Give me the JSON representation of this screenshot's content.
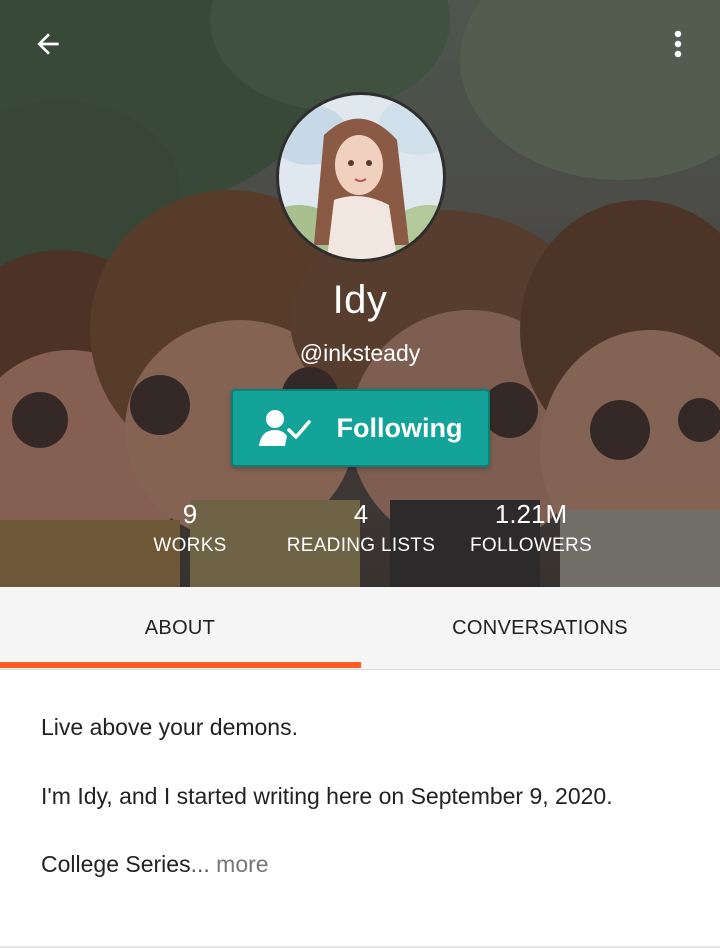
{
  "profile": {
    "display_name": "Idy",
    "username": "@inksteady",
    "follow_button_label": "Following"
  },
  "stats": {
    "works": {
      "value": "9",
      "label": "WORKS"
    },
    "reading_lists": {
      "value": "4",
      "label": "READING LISTS"
    },
    "followers": {
      "value": "1.21M",
      "label": "FOLLOWERS"
    }
  },
  "tabs": [
    {
      "label": "ABOUT",
      "active": true
    },
    {
      "label": "CONVERSATIONS",
      "active": false
    }
  ],
  "about": {
    "line1": "Live above your demons.",
    "line2": "I'm Idy, and I started writing here on September 9, 2020.",
    "line3": "College Series",
    "ellipsis": "...",
    "more_label": " more"
  },
  "icons": {
    "back": "arrow-left-icon",
    "more": "more-vertical-icon",
    "follow": "person-check-icon"
  },
  "colors": {
    "accent_teal": "#14a399",
    "tab_indicator_orange": "#ff5a1f"
  }
}
